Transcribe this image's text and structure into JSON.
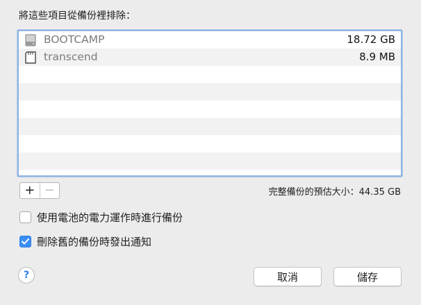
{
  "dialog": {
    "title": "將這些項目從備份裡排除：",
    "items": [
      {
        "icon": "hard-drive-icon",
        "name": "BOOTCAMP",
        "size": "18.72 GB"
      },
      {
        "icon": "sd-card-icon",
        "name": "transcend",
        "size": "8.9 MB"
      }
    ],
    "add_label": "+",
    "remove_label": "−",
    "total_label": "完整備份的預估大小：44.35 GB",
    "battery_option": {
      "label": "使用電池的電力運作時進行備份",
      "checked": false
    },
    "notify_option": {
      "label": "刪除舊的備份時發出通知",
      "checked": true
    },
    "help_label": "?",
    "cancel_label": "取消",
    "save_label": "儲存"
  },
  "colors": {
    "accent": "#3a8ef6",
    "focus_ring": "#8fb2e0",
    "row_stripe": "#f2f2f2"
  }
}
